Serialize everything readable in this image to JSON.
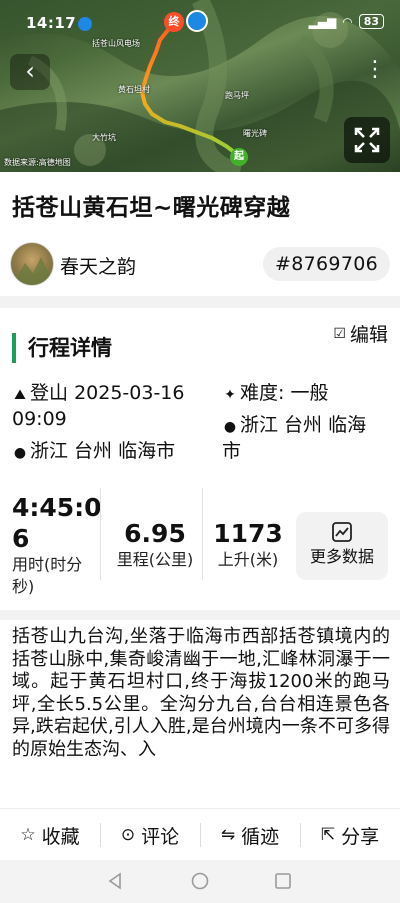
{
  "status_bar": {
    "time": "14:17",
    "battery": "83"
  },
  "map": {
    "credit": "数据来源:高德地图",
    "labels": [
      "括苍山风电场",
      "黄石坦村",
      "跑马坪",
      "曙光碑",
      "大竹坑"
    ],
    "start_marker": "起",
    "end_marker": "终"
  },
  "title": "括苍山黄石坦~曙光碑穿越",
  "author": {
    "name": "春天之韵",
    "trip_id": "#8769706"
  },
  "details": {
    "section_title": "行程详情",
    "edit_label": "编辑",
    "type": "登山",
    "date": "2025-03-16",
    "time": "09:09",
    "difficulty_label": "难度:",
    "difficulty_value": "一般",
    "start_location": "浙江 台州 临海市",
    "end_location_line1": "浙江 台州 临海",
    "end_location_line2": "市"
  },
  "stats": {
    "duration": {
      "value_line1": "4:45:0",
      "value_line2": "6",
      "label_line1": "用时(时分",
      "label_line2": "秒)"
    },
    "distance": {
      "value": "6.95",
      "label": "里程(公里)"
    },
    "ascent": {
      "value": "1173",
      "label": "上升(米)"
    },
    "more_label": "更多数据"
  },
  "description": "括苍山九台沟,坐落于临海市西部括苍镇境内的括苍山脉中,集奇峻清幽于一地,汇峰林洞瀑于一域。起于黄石坦村口,终于海拔1200米的跑马坪,全长5.5公里。全沟分九台,台台相连景色各异,跌宕起伏,引人入胜,是台州境内一条不可多得的原始生态沟、入",
  "actions": [
    {
      "label": "收藏",
      "icon": "star-icon"
    },
    {
      "label": "评论",
      "icon": "comment-icon"
    },
    {
      "label": "循迹",
      "icon": "route-icon"
    },
    {
      "label": "分享",
      "icon": "share-icon"
    }
  ],
  "colors": {
    "accent": "#18a058",
    "track_start": "#8ed43a",
    "track_end": "#ff5a1f"
  }
}
